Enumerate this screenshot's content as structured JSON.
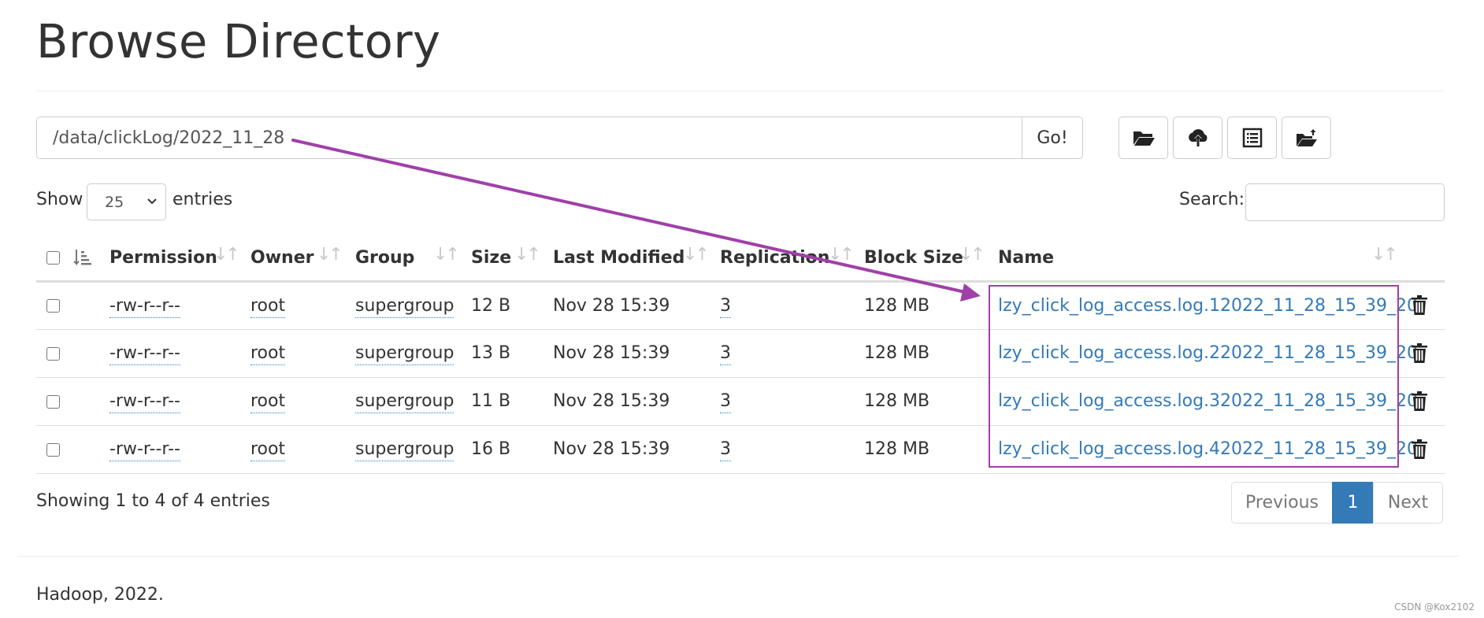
{
  "page_title": "Browse Directory",
  "path_bar": {
    "value": "/data/clickLog/2022_11_28",
    "go_label": "Go!"
  },
  "toolbar_icons": [
    "folder-open-icon",
    "cloud-upload-icon",
    "list-alt-icon",
    "folder-upload-icon"
  ],
  "length_control": {
    "show_label": "Show",
    "selected": "25",
    "entries_label": "entries"
  },
  "search": {
    "label": "Search:",
    "value": ""
  },
  "columns": [
    "Permission",
    "Owner",
    "Group",
    "Size",
    "Last Modified",
    "Replication",
    "Block Size",
    "Name"
  ],
  "rows": [
    {
      "permission": "-rw-r--r--",
      "owner": "root",
      "group": "supergroup",
      "size": "12 B",
      "modified": "Nov 28 15:39",
      "replication": "3",
      "block_size": "128 MB",
      "name": "lzy_click_log_access.log.12022_11_28_15_39_20"
    },
    {
      "permission": "-rw-r--r--",
      "owner": "root",
      "group": "supergroup",
      "size": "13 B",
      "modified": "Nov 28 15:39",
      "replication": "3",
      "block_size": "128 MB",
      "name": "lzy_click_log_access.log.22022_11_28_15_39_20"
    },
    {
      "permission": "-rw-r--r--",
      "owner": "root",
      "group": "supergroup",
      "size": "11 B",
      "modified": "Nov 28 15:39",
      "replication": "3",
      "block_size": "128 MB",
      "name": "lzy_click_log_access.log.32022_11_28_15_39_20"
    },
    {
      "permission": "-rw-r--r--",
      "owner": "root",
      "group": "supergroup",
      "size": "16 B",
      "modified": "Nov 28 15:39",
      "replication": "3",
      "block_size": "128 MB",
      "name": "lzy_click_log_access.log.42022_11_28_15_39_20"
    }
  ],
  "info_text": "Showing 1 to 4 of 4 entries",
  "pagination": {
    "previous": "Previous",
    "current": "1",
    "next": "Next"
  },
  "footer": "Hadoop, 2022.",
  "watermark": "CSDN @Kox2102",
  "colors": {
    "link": "#337ab7",
    "annotation": "#a040a8",
    "active_page": "#337ab7"
  }
}
